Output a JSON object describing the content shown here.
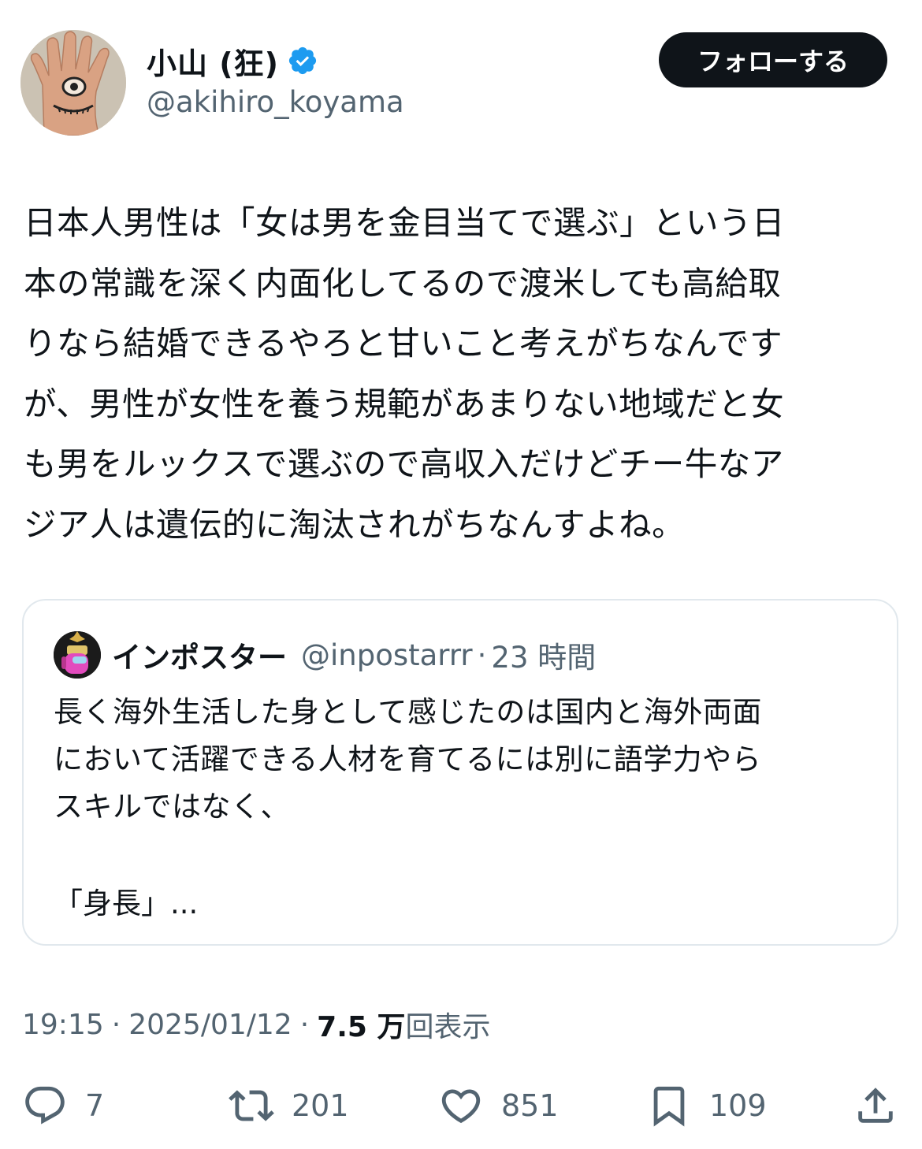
{
  "user": {
    "display_name": "小山 (狂)",
    "handle": "@akihiro_koyama",
    "verified": true
  },
  "follow_label": "フォローする",
  "tweet": {
    "text": "日本人男性は「女は男を金目当てで選ぶ」という日\n本の常識を深く内面化してるので渡米しても高給取\nりなら結婚できるやろと甘いこと考えがちなんです\nが、男性が女性を養う規範があまりない地域だと女\nも男をルックスで選ぶので高収入だけどチー牛なア\nジア人は遺伝的に淘汰されがちなんすよね。"
  },
  "quote": {
    "name": "インポスター",
    "handle": "@inpostarrr",
    "separator": "·",
    "time": "23 時間",
    "text": "長く海外生活した身として感じたのは国内と海外両面\nにおいて活躍できる人材を育てるには別に語学力やら\nスキルではなく、",
    "text2": "「身長」..."
  },
  "meta": {
    "time": "19:15",
    "separator": "·",
    "date": "2025/01/12",
    "views_count": "7.5 万",
    "views_label": "回表示"
  },
  "actions": {
    "reply_count": "7",
    "retweet_count": "201",
    "like_count": "851",
    "bookmark_count": "109"
  },
  "colors": {
    "verified": "#1d9bf0",
    "text": "#0f1419",
    "secondary": "#536471",
    "border": "#e1e8ed"
  }
}
